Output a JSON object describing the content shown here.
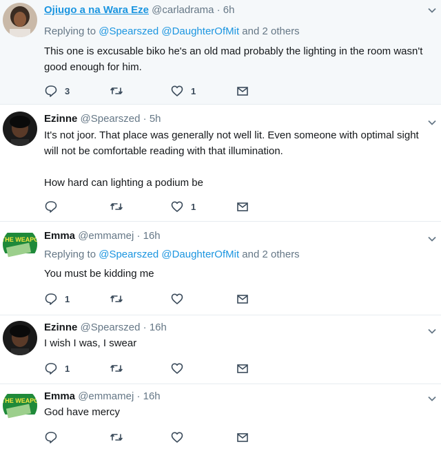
{
  "replying_label": "Replying to",
  "and_label": "and",
  "tweets": [
    {
      "name": "Ojiugo a na Wara Eze",
      "handle": "@carladrama",
      "sep": "·",
      "time": "6h",
      "replying": {
        "mentions": [
          "@Spearszed",
          "@DaughterOfMit"
        ],
        "others": "2 others"
      },
      "text": "This one is excusable biko he's an old mad probably the lighting in the room wasn't good enough for him.",
      "reply_count": "3",
      "retweet_count": "",
      "like_count": "1"
    },
    {
      "name": "Ezinne",
      "handle": "@Spearszed",
      "sep": "·",
      "time": "5h",
      "text_1": "It's not joor. That place was generally not well lit. Even someone with optimal sight will not be comfortable reading with that illumination.",
      "text_2": "How hard can lighting  a podium be",
      "reply_count": "",
      "retweet_count": "",
      "like_count": "1"
    },
    {
      "name": "Emma",
      "handle": "@emmamej",
      "sep": "·",
      "time": "16h",
      "replying": {
        "mentions": [
          "@Spearszed",
          "@DaughterOfMit"
        ],
        "others": "2 others"
      },
      "text": "You must be kidding me",
      "reply_count": "1",
      "retweet_count": "",
      "like_count": ""
    },
    {
      "name": "Ezinne",
      "handle": "@Spearszed",
      "sep": "·",
      "time": "16h",
      "text": "I wish I was, I swear",
      "reply_count": "1",
      "retweet_count": "",
      "like_count": ""
    },
    {
      "name": "Emma",
      "handle": "@emmamej",
      "sep": "·",
      "time": "16h",
      "text": "God have mercy",
      "reply_count": "",
      "retweet_count": "",
      "like_count": ""
    }
  ],
  "avatar_logo_text": "THE WEAPO",
  "colors": {
    "link": "#1b95e0",
    "secondary": "#657786",
    "border": "#e6ecf0",
    "highlight_bg": "#f5f8fa"
  }
}
